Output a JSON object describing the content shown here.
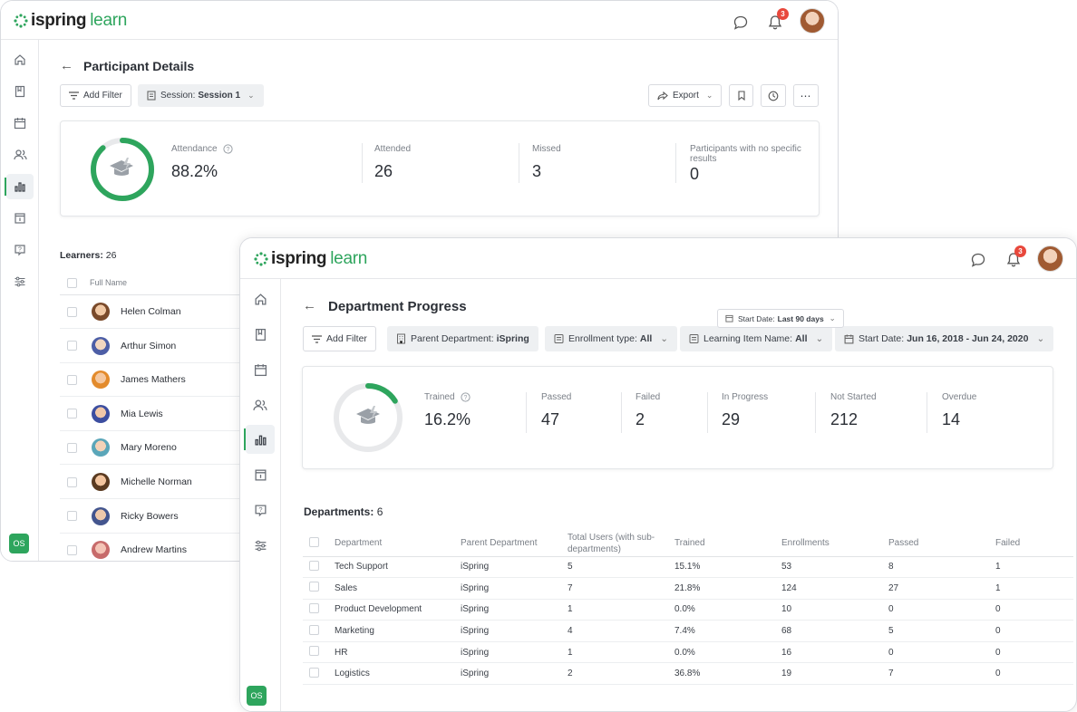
{
  "brand": {
    "bold": "ispring",
    "light": "learn",
    "green": "#2ea55d"
  },
  "notifications_count": "3",
  "user_initials": "OS",
  "participant": {
    "title": "Participant Details",
    "add_filter": "Add Filter",
    "session_label": "Session:",
    "session_value": "Session 1",
    "export": "Export",
    "stats": {
      "attendance_label": "Attendance",
      "attendance_value": "88.2%",
      "attendance_fraction": 0.882,
      "attended_label": "Attended",
      "attended_value": "26",
      "missed_label": "Missed",
      "missed_value": "3",
      "noresult_label": "Participants with no specific results",
      "noresult_value": "0"
    },
    "learners_label": "Learners:",
    "learners_count": "26",
    "fullname_header": "Full Name",
    "learners": [
      "Helen Colman",
      "Arthur Simon",
      "James Mathers",
      "Mia Lewis",
      "Mary Moreno",
      "Michelle Norman",
      "Ricky Bowers",
      "Andrew Martins"
    ]
  },
  "department": {
    "title": "Department Progress",
    "start_date_chip": "Start Date:",
    "start_date_chip_value": "Last 90 days",
    "add_filter": "Add Filter",
    "parent_department_label": "Parent Department:",
    "parent_department_value": "iSpring",
    "enrollment_label": "Enrollment type:",
    "enrollment_value": "All",
    "learning_item_label": "Learning Item Name:",
    "learning_item_value": "All",
    "start_date_label": "Start Date:",
    "start_date_value": "Jun 16, 2018 - Jun 24, 2020",
    "stats": {
      "trained_label": "Trained",
      "trained_value": "16.2%",
      "trained_fraction": 0.162,
      "passed_label": "Passed",
      "passed_value": "47",
      "failed_label": "Failed",
      "failed_value": "2",
      "inprogress_label": "In Progress",
      "inprogress_value": "29",
      "notstarted_label": "Not Started",
      "notstarted_value": "212",
      "overdue_label": "Overdue",
      "overdue_value": "14"
    },
    "departments_label": "Departments:",
    "departments_count": "6",
    "columns": [
      "Department",
      "Parent Department",
      "Total Users (with sub-departments)",
      "Trained",
      "Enrollments",
      "Passed",
      "Failed"
    ],
    "rows": [
      [
        "Tech Support",
        "iSpring",
        "5",
        "15.1%",
        "53",
        "8",
        "1"
      ],
      [
        "Sales",
        "iSpring",
        "7",
        "21.8%",
        "124",
        "27",
        "1"
      ],
      [
        "Product Development",
        "iSpring",
        "1",
        "0.0%",
        "10",
        "0",
        "0"
      ],
      [
        "Marketing",
        "iSpring",
        "4",
        "7.4%",
        "68",
        "5",
        "0"
      ],
      [
        "HR",
        "iSpring",
        "1",
        "0.0%",
        "16",
        "0",
        "0"
      ],
      [
        "Logistics",
        "iSpring",
        "2",
        "36.8%",
        "19",
        "7",
        "0"
      ]
    ]
  }
}
